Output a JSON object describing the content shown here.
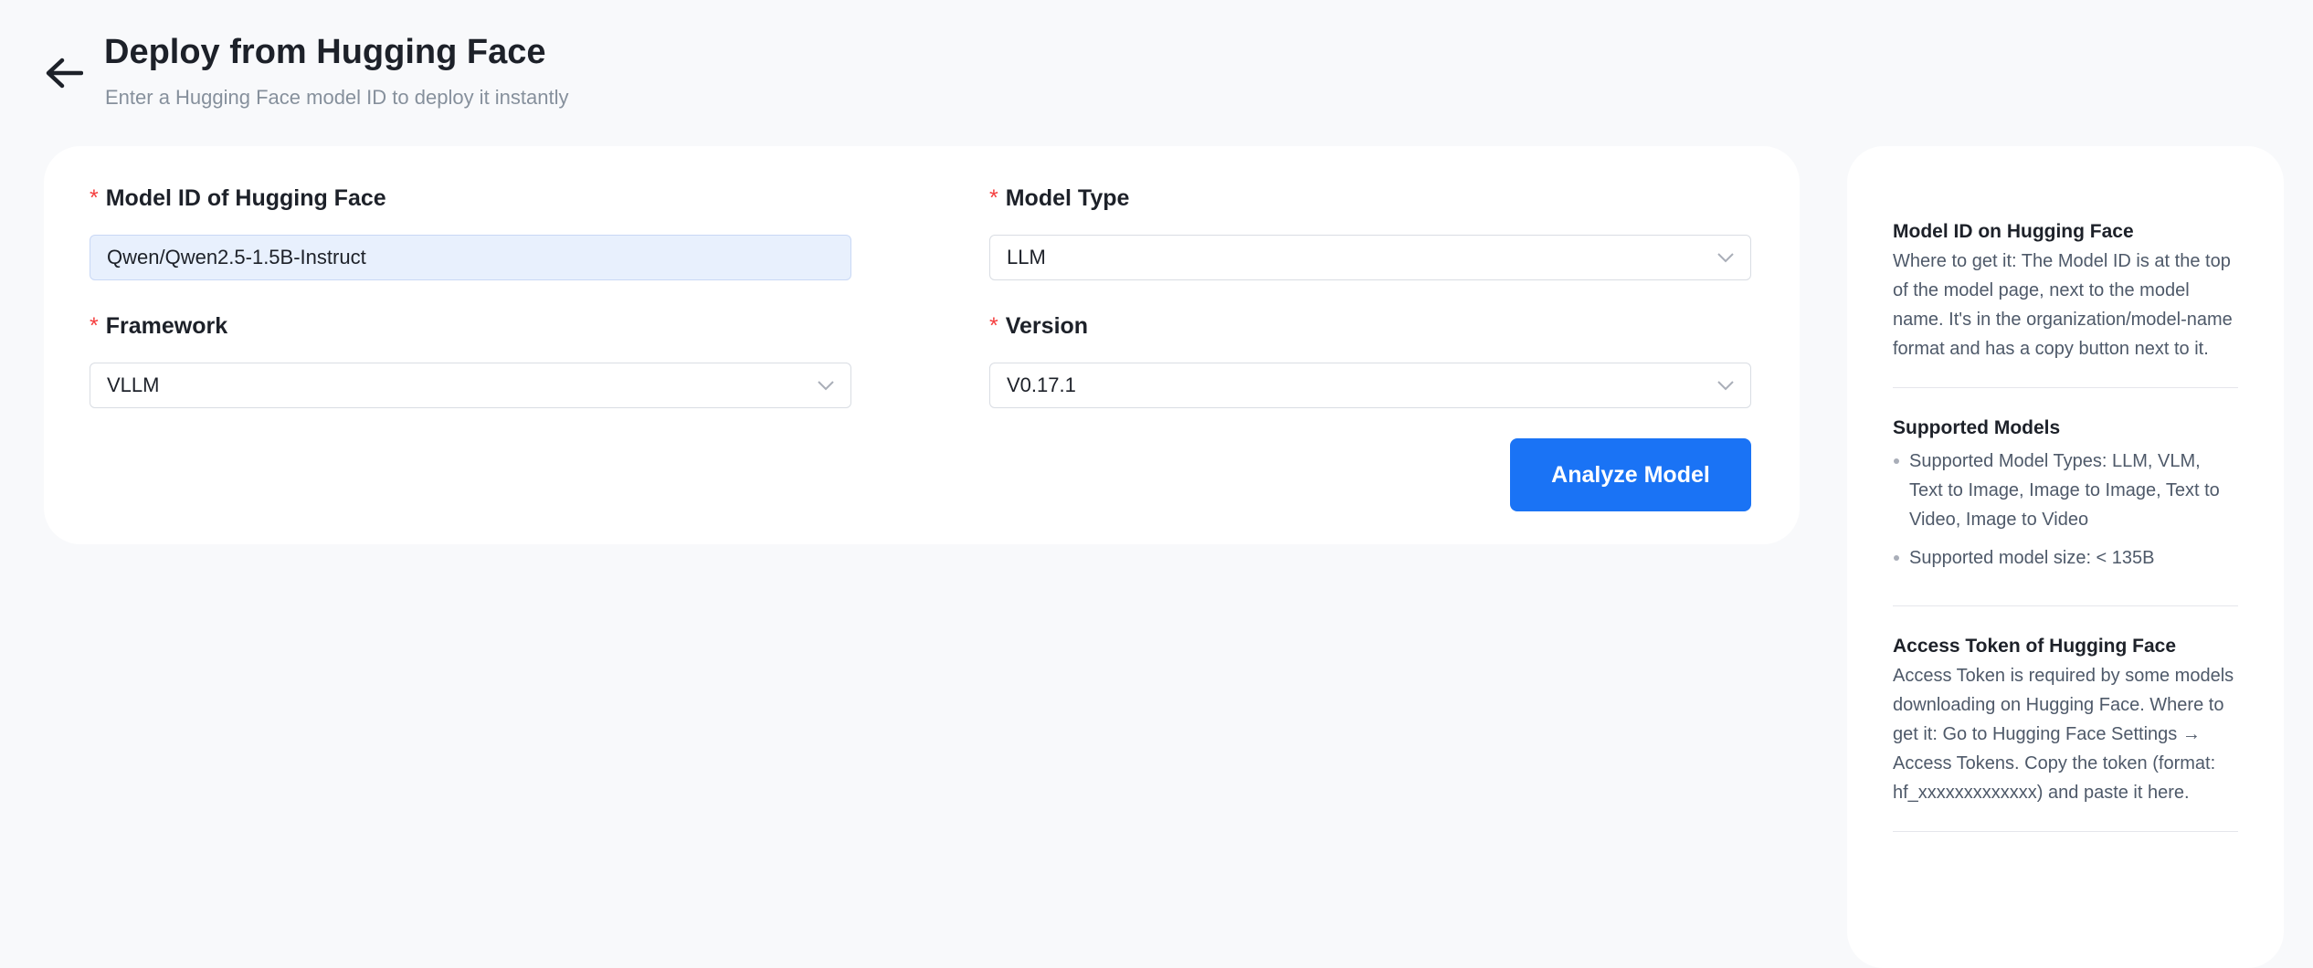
{
  "header": {
    "title": "Deploy from Hugging Face",
    "subtitle": "Enter a Hugging Face model ID to deploy it instantly",
    "back_icon": "arrow-left-icon"
  },
  "form": {
    "model_id": {
      "label": "Model ID of Hugging Face",
      "required_mark": "*",
      "value": "Qwen/Qwen2.5-1.5B-Instruct"
    },
    "model_type": {
      "label": "Model Type",
      "required_mark": "*",
      "value": "LLM"
    },
    "framework": {
      "label": "Framework",
      "required_mark": "*",
      "value": "VLLM"
    },
    "version": {
      "label": "Version",
      "required_mark": "*",
      "value": "V0.17.1"
    },
    "analyze_button": "Analyze Model"
  },
  "info": {
    "model_id_section": {
      "title": "Model ID on Hugging Face",
      "text": "Where to get it: The Model ID is at the top of the model page, next to the model name. It's in the organization/model-name format and has a copy button next to it."
    },
    "supported_section": {
      "title": "Supported Models",
      "items": [
        "Supported Model Types: LLM, VLM, Text to Image, Image to Image, Text to Video, Image to Video",
        "Supported model size: < 135B"
      ]
    },
    "token_section": {
      "title": "Access Token of Hugging Face",
      "text": "Access Token is required by some models downloading on Hugging Face. Where to get it: Go to Hugging Face Settings → Access Tokens. Copy the token (format: hf_xxxxxxxxxxxxx) and paste it here."
    }
  },
  "colors": {
    "accent": "#1a73f5",
    "required": "#f53f3f",
    "focused_input_bg": "#e8f0fd",
    "page_bg": "#f8f9fb"
  }
}
